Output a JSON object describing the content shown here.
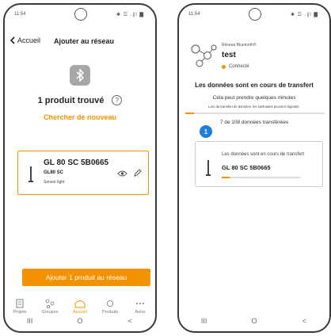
{
  "left": {
    "status": {
      "time": "11:54",
      "indicators": "✱ ☲ .∥l ▇"
    },
    "header": {
      "back_label": "Accueil",
      "title": "Ajouter au réseau"
    },
    "found_text": "1 produit trouvé",
    "help_symbol": "?",
    "search_again": "Chercher de nouveau",
    "product": {
      "name": "GL 80 SC 5B0665",
      "model": "GL80 SC",
      "type": "Sensor light"
    },
    "add_button": "Ajouter 1 produit au réseau",
    "tabs": [
      {
        "label": "Projets",
        "icon": "projects-icon"
      },
      {
        "label": "Groupes",
        "icon": "groups-icon"
      },
      {
        "label": "Accueil",
        "icon": "home-icon",
        "active": true
      },
      {
        "label": "Produits",
        "icon": "products-icon"
      },
      {
        "label": "Autre",
        "icon": "more-icon"
      }
    ],
    "nav": {
      "recent": "III",
      "home": "O",
      "back": "<"
    }
  },
  "right": {
    "status": {
      "time": "11:54",
      "indicators": "✱ ☲ .∥l ▇"
    },
    "network": {
      "label": "Réseau Bluetooth®",
      "name": "test",
      "status": "Connecté"
    },
    "transfer": {
      "title": "Les données sont en cours de transfert",
      "subtitle": "Cela peut prendre quelques minutes",
      "note": "Lors du transfert de données, les luminaires peuvent clignoter.",
      "progress_fraction": 0.065,
      "count": "7 de 108 données transférées"
    },
    "device": {
      "step": "1",
      "status": "Les données sont en cours de transfert",
      "name": "GL 80 SC 5B0665",
      "progress_fraction": 0.1
    },
    "nav": {
      "recent": "III",
      "home": "O",
      "back": "<"
    }
  },
  "colors": {
    "accent": "#f39200",
    "badge": "#1e7fd8",
    "bt_badge": "#a7a7a7"
  }
}
